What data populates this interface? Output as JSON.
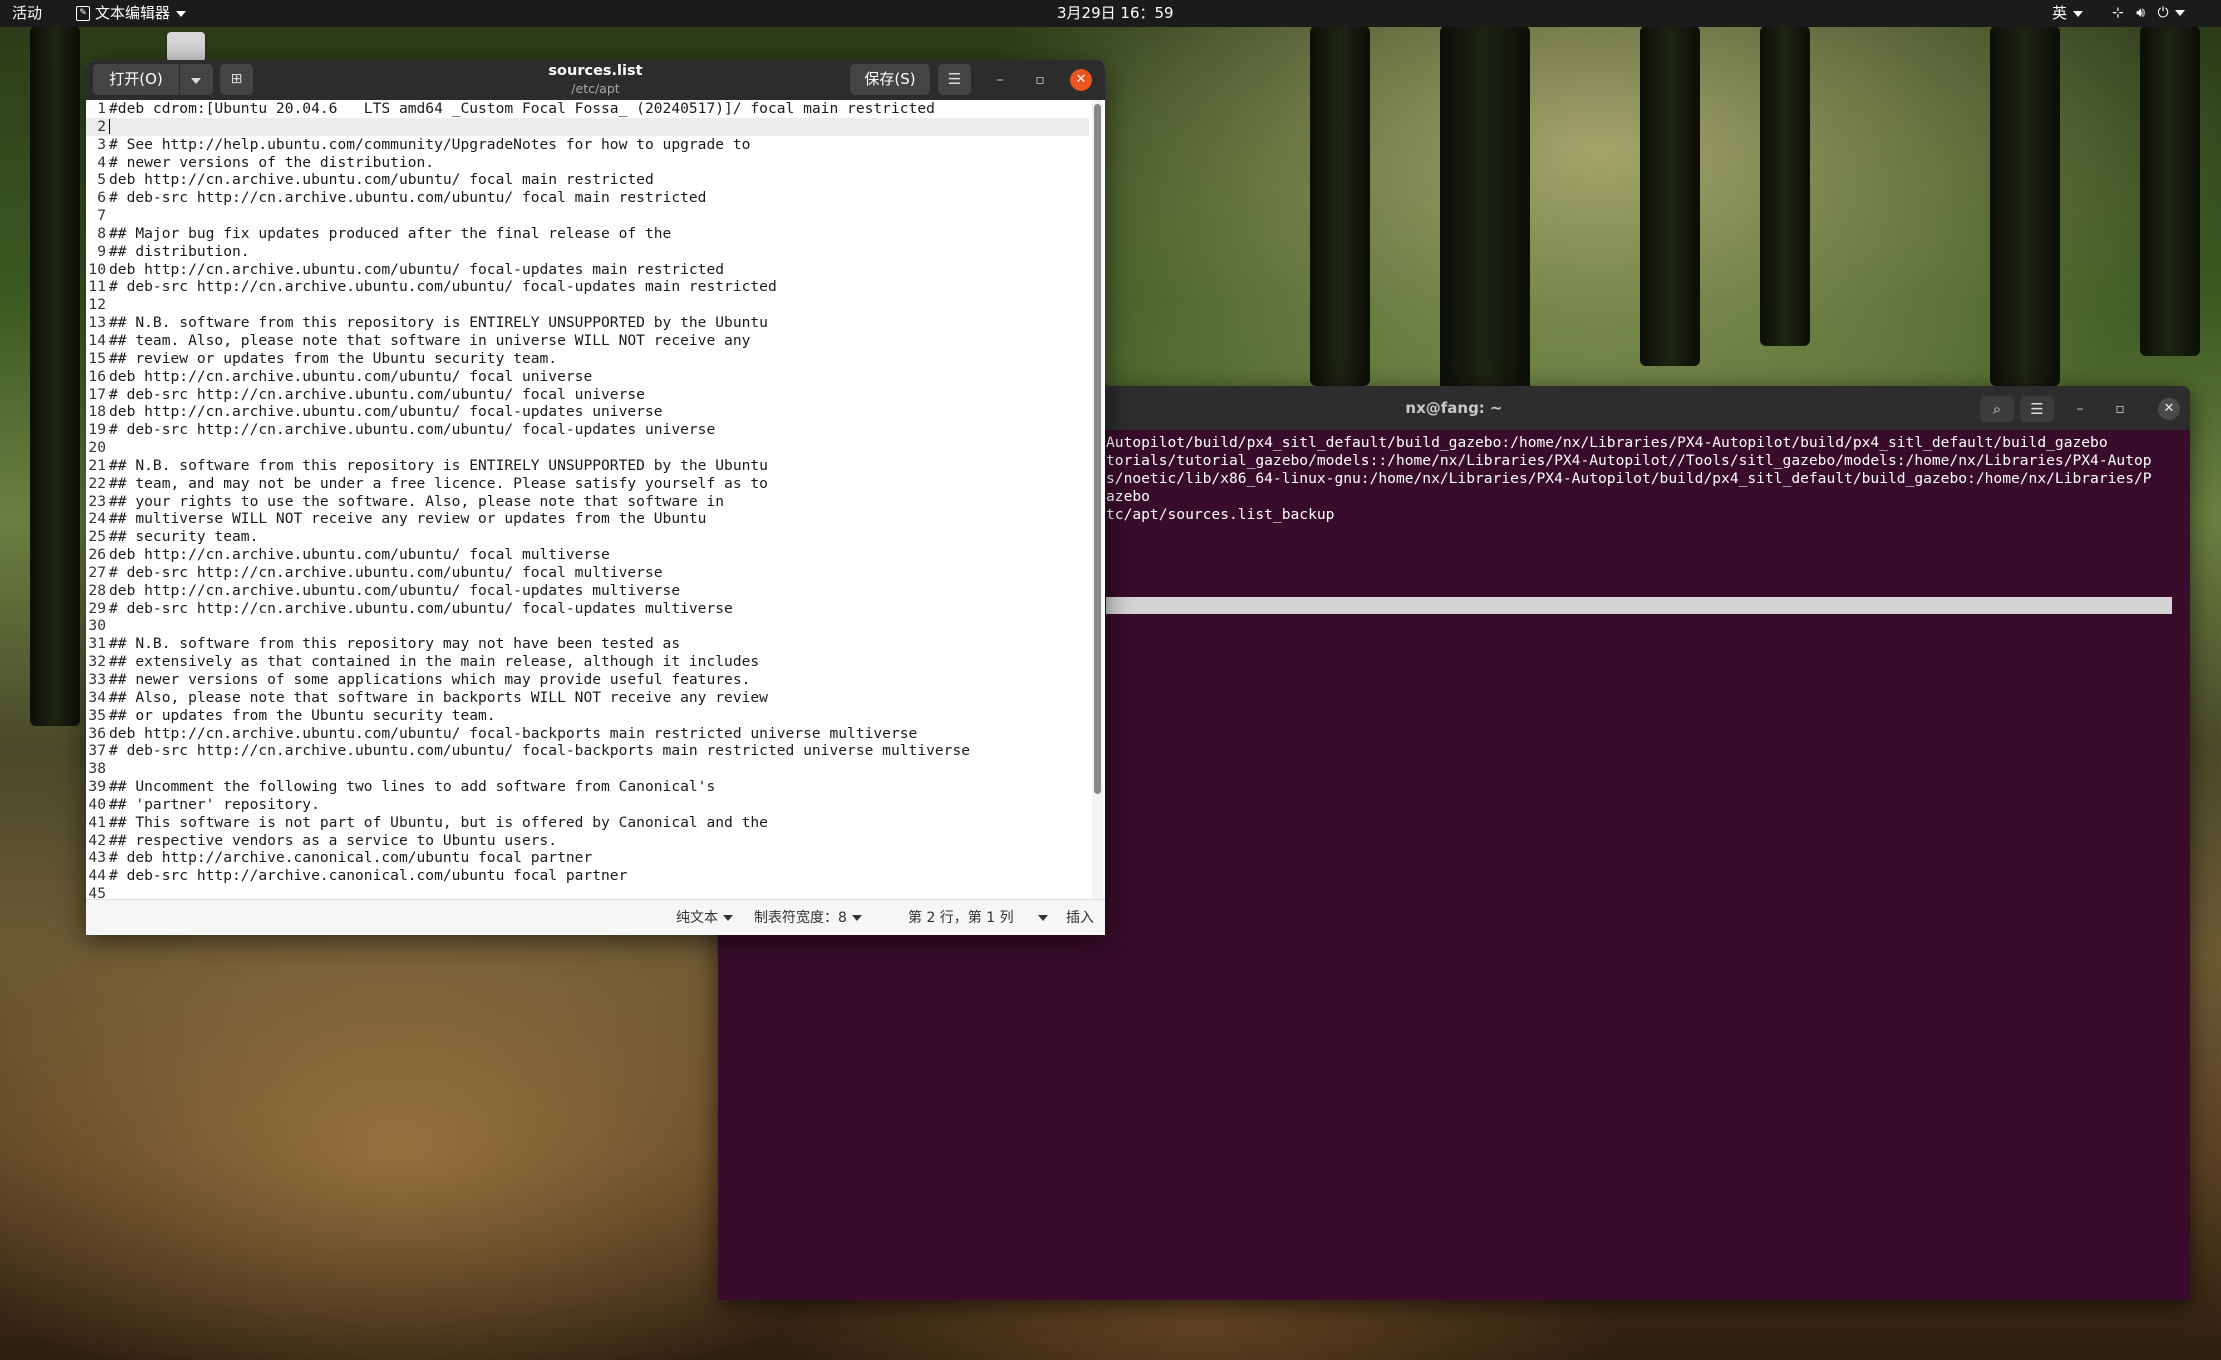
{
  "topbar": {
    "activities": "活动",
    "app_name": "文本编辑器",
    "clock": "3月29日 16：59",
    "input_method": "英"
  },
  "editor": {
    "open_label": "打开(O)",
    "title": "sources.list",
    "subtitle": "/etc/apt",
    "save_label": "保存(S)",
    "lines": [
      "#deb cdrom:[Ubuntu 20.04.6   LTS amd64 _Custom Focal Fossa_ (20240517)]/ focal main restricted",
      "",
      "# See http://help.ubuntu.com/community/UpgradeNotes for how to upgrade to",
      "# newer versions of the distribution.",
      "deb http://cn.archive.ubuntu.com/ubuntu/ focal main restricted",
      "# deb-src http://cn.archive.ubuntu.com/ubuntu/ focal main restricted",
      "",
      "## Major bug fix updates produced after the final release of the",
      "## distribution.",
      "deb http://cn.archive.ubuntu.com/ubuntu/ focal-updates main restricted",
      "# deb-src http://cn.archive.ubuntu.com/ubuntu/ focal-updates main restricted",
      "",
      "## N.B. software from this repository is ENTIRELY UNSUPPORTED by the Ubuntu",
      "## team. Also, please note that software in universe WILL NOT receive any",
      "## review or updates from the Ubuntu security team.",
      "deb http://cn.archive.ubuntu.com/ubuntu/ focal universe",
      "# deb-src http://cn.archive.ubuntu.com/ubuntu/ focal universe",
      "deb http://cn.archive.ubuntu.com/ubuntu/ focal-updates universe",
      "# deb-src http://cn.archive.ubuntu.com/ubuntu/ focal-updates universe",
      "",
      "## N.B. software from this repository is ENTIRELY UNSUPPORTED by the Ubuntu",
      "## team, and may not be under a free licence. Please satisfy yourself as to",
      "## your rights to use the software. Also, please note that software in",
      "## multiverse WILL NOT receive any review or updates from the Ubuntu",
      "## security team.",
      "deb http://cn.archive.ubuntu.com/ubuntu/ focal multiverse",
      "# deb-src http://cn.archive.ubuntu.com/ubuntu/ focal multiverse",
      "deb http://cn.archive.ubuntu.com/ubuntu/ focal-updates multiverse",
      "# deb-src http://cn.archive.ubuntu.com/ubuntu/ focal-updates multiverse",
      "",
      "## N.B. software from this repository may not have been tested as",
      "## extensively as that contained in the main release, although it includes",
      "## newer versions of some applications which may provide useful features.",
      "## Also, please note that software in backports WILL NOT receive any review",
      "## or updates from the Ubuntu security team.",
      "deb http://cn.archive.ubuntu.com/ubuntu/ focal-backports main restricted universe multiverse",
      "# deb-src http://cn.archive.ubuntu.com/ubuntu/ focal-backports main restricted universe multiverse",
      "",
      "## Uncomment the following two lines to add software from Canonical's",
      "## 'partner' repository.",
      "## This software is not part of Ubuntu, but is offered by Canonical and the",
      "## respective vendors as a service to Ubuntu users.",
      "# deb http://archive.canonical.com/ubuntu focal partner",
      "# deb-src http://archive.canonical.com/ubuntu focal partner",
      ""
    ],
    "current_line": 2,
    "status": {
      "language": "纯文本",
      "tab_width": "制表符宽度：8",
      "position": "第 2 行，第 1 列",
      "mode": "插入"
    }
  },
  "terminal": {
    "title": "nx@fang: ~",
    "lines": [
      "Autopilot/build/px4_sitl_default/build_gazebo:/home/nx/Libraries/PX4-Autopilot/build/px4_sitl_default/build_gazebo",
      "torials/tutorial_gazebo/models::/home/nx/Libraries/PX4-Autopilot//Tools/sitl_gazebo/models:/home/nx/Libraries/PX4-Autop",
      "",
      "s/noetic/lib/x86_64-linux-gnu:/home/nx/Libraries/PX4-Autopilot/build/px4_sitl_default/build_gazebo:/home/nx/Libraries/P",
      "azebo",
      "tc/apt/sources.list_backup"
    ]
  },
  "colors": {
    "accent": "#e95420",
    "terminal_bg": "#380c2a",
    "header_bg": "#2c2c2c"
  }
}
